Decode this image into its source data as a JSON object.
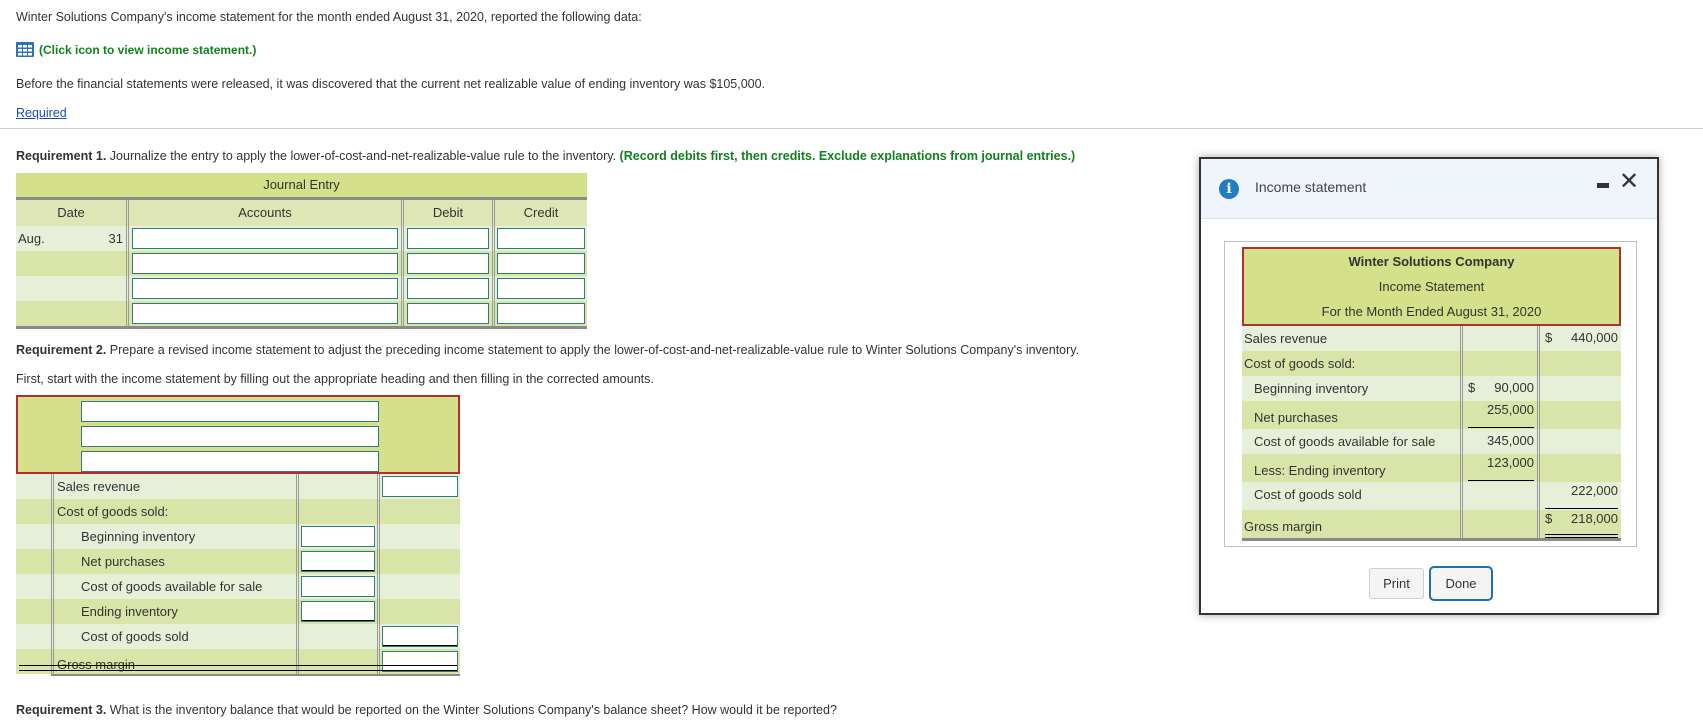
{
  "intro": {
    "line1": "Winter Solutions Company's income statement for the month ended August 31, 2020, reported the following data:",
    "icon_link": "(Click icon to view income statement.)",
    "line2": "Before the financial statements were released, it was discovered that the current net realizable value of ending inventory was $105,000.",
    "required_link": "Required"
  },
  "req1": {
    "label": "Requirement 1.",
    "text": " Journalize the entry to apply the lower-of-cost-and-net-realizable-value rule to the inventory. ",
    "instruction": "(Record debits first, then credits. Exclude explanations from journal entries.)"
  },
  "journal": {
    "title": "Journal Entry",
    "headers": [
      "Date",
      "Accounts",
      "Debit",
      "Credit"
    ],
    "date_month": "Aug.",
    "date_day": "31",
    "rows": [
      {
        "account": "",
        "debit": "",
        "credit": ""
      },
      {
        "account": "",
        "debit": "",
        "credit": ""
      },
      {
        "account": "",
        "debit": "",
        "credit": ""
      },
      {
        "account": "",
        "debit": "",
        "credit": ""
      }
    ]
  },
  "req2": {
    "label": "Requirement 2.",
    "text": " Prepare a revised income statement to adjust the preceding income statement to apply the lower-of-cost-and-net-realizable-value rule to Winter Solutions Company's inventory.",
    "subtext": "First, start with the income statement by filling out the appropriate heading and then filling in the corrected amounts.",
    "heading_inputs": [
      "",
      "",
      ""
    ],
    "rows": [
      {
        "label": "Sales revenue",
        "indent": false
      },
      {
        "label": "Cost of goods sold:",
        "indent": false
      },
      {
        "label": "Beginning inventory",
        "indent": true
      },
      {
        "label": "Net purchases",
        "indent": true
      },
      {
        "label": "Cost of goods available for sale",
        "indent": true
      },
      {
        "label": "Ending inventory",
        "indent": true
      },
      {
        "label": "Cost of goods sold",
        "indent": true
      },
      {
        "label": "Gross margin",
        "indent": false
      }
    ]
  },
  "req3": {
    "label": "Requirement 3.",
    "text": " What is the inventory balance that would be reported on the Winter Solutions Company's balance sheet? How would it be reported?"
  },
  "modal": {
    "title": "Income statement",
    "statement": {
      "company": "Winter Solutions Company",
      "name": "Income Statement",
      "period": "For the Month Ended August 31, 2020",
      "rows": [
        {
          "label": "Sales revenue",
          "mid_cur": "",
          "mid": "",
          "right_cur": "$",
          "right": "440,000"
        },
        {
          "label": "Cost of goods sold:",
          "mid_cur": "",
          "mid": "",
          "right_cur": "",
          "right": ""
        },
        {
          "label": "Beginning inventory",
          "mid_cur": "$",
          "mid": "90,000",
          "right_cur": "",
          "right": ""
        },
        {
          "label": "Net purchases",
          "mid_cur": "",
          "mid": "255,000",
          "right_cur": "",
          "right": ""
        },
        {
          "label": "Cost of goods available for sale",
          "mid_cur": "",
          "mid": "345,000",
          "right_cur": "",
          "right": ""
        },
        {
          "label": "Less: Ending inventory",
          "mid_cur": "",
          "mid": "123,000",
          "right_cur": "",
          "right": ""
        },
        {
          "label": "Cost of goods sold",
          "mid_cur": "",
          "mid": "",
          "right_cur": "",
          "right": "222,000"
        },
        {
          "label": "Gross margin",
          "mid_cur": "",
          "mid": "",
          "right_cur": "$",
          "right": "218,000"
        }
      ]
    },
    "print_label": "Print",
    "done_label": "Done"
  },
  "colors": {
    "header_band": "#d4e08a",
    "row_light": "#e6efd8",
    "row_dark": "#d8e4a8",
    "heading_border": "#b03030",
    "instruction_green": "#11821f",
    "link_blue": "#1a4fb5",
    "done_focus": "#1f6fb5"
  }
}
